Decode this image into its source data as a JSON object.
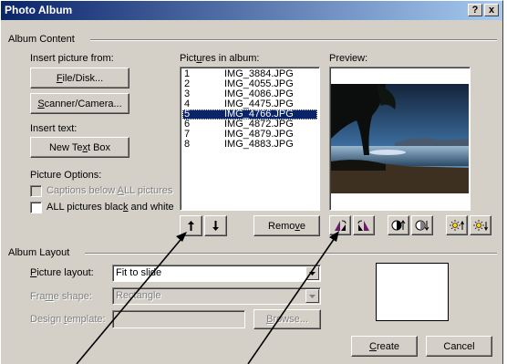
{
  "window": {
    "title": "Photo Album",
    "help_label": "?",
    "close_label": "x"
  },
  "album_content": {
    "group_label": "Album Content",
    "insert_from_label": "Insert picture from:",
    "file_disk": {
      "pre": "",
      "key": "F",
      "post": "ile/Disk..."
    },
    "scanner": {
      "pre": "",
      "key": "S",
      "post": "canner/Camera..."
    },
    "insert_text_label": "Insert text:",
    "new_textbox": {
      "pre": "New Te",
      "key": "x",
      "post": "t Box"
    },
    "picture_options_label": "Picture Options:",
    "captions": {
      "pre": "Captions below ",
      "key": "A",
      "post": "LL pictures"
    },
    "bw": {
      "pre": "ALL pictures blac",
      "key": "k",
      "post": " and white"
    }
  },
  "pictures": {
    "label": {
      "pre": "Pict",
      "key": "u",
      "post": "res in album:"
    },
    "items": [
      {
        "num": "1",
        "name": "IMG_3884.JPG",
        "selected": false
      },
      {
        "num": "2",
        "name": "IMG_4055.JPG",
        "selected": false
      },
      {
        "num": "3",
        "name": "IMG_4086.JPG",
        "selected": false
      },
      {
        "num": "4",
        "name": "IMG_4475.JPG",
        "selected": false
      },
      {
        "num": "5",
        "name": "IMG_4766.JPG",
        "selected": true
      },
      {
        "num": "6",
        "name": "IMG_4872.JPG",
        "selected": false
      },
      {
        "num": "7",
        "name": "IMG_4879.JPG",
        "selected": false
      },
      {
        "num": "8",
        "name": "IMG_4883.JPG",
        "selected": false
      }
    ],
    "move_up_icon": "up-arrow",
    "move_down_icon": "down-arrow",
    "remove": {
      "pre": "Remo",
      "key": "v",
      "post": "e"
    }
  },
  "preview": {
    "label": "Preview:",
    "tool_icons": [
      "rotate-left-icon",
      "rotate-right-icon",
      "contrast-up-icon",
      "contrast-down-icon",
      "brightness-up-icon",
      "brightness-down-icon"
    ]
  },
  "album_layout": {
    "group_label": "Album Layout",
    "picture_layout": {
      "pre": "",
      "key": "P",
      "post": "icture layout:",
      "value": "Fit to slide"
    },
    "frame_shape": {
      "pre": "Fra",
      "key": "m",
      "post": "e shape:",
      "value": "Rectangle"
    },
    "design_template": {
      "pre": "Design ",
      "key": "t",
      "post": "emplate:",
      "value": ""
    },
    "browse": {
      "pre": "",
      "key": "B",
      "post": "rowse..."
    }
  },
  "footer": {
    "create": {
      "pre": "",
      "key": "C",
      "post": "reate"
    },
    "cancel": "Cancel"
  },
  "colors": {
    "titlebar_start": "#0a246a",
    "titlebar_end": "#a6caf0",
    "selection": "#0a246a",
    "face": "#d4d0c8"
  }
}
